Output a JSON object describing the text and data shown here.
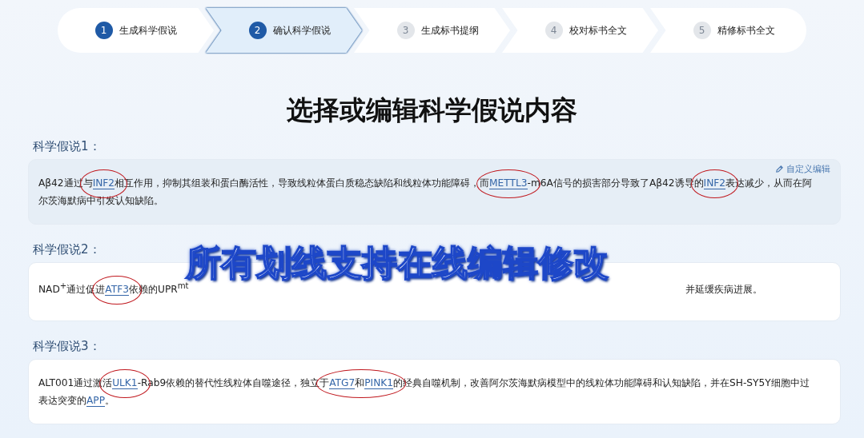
{
  "steps": [
    {
      "number": "1",
      "label": "生成科学假说",
      "selected": false,
      "done": true
    },
    {
      "number": "2",
      "label": "确认科学假说",
      "selected": true,
      "done": false
    },
    {
      "number": "3",
      "label": "生成标书提纲",
      "selected": false,
      "done": false
    },
    {
      "number": "4",
      "label": "校对标书全文",
      "selected": false,
      "done": false
    },
    {
      "number": "5",
      "label": "精修标书全文",
      "selected": false,
      "done": false
    }
  ],
  "title": "选择或编辑科学假说内容",
  "hypotheses": [
    {
      "label": "科学假说1：",
      "selected": true,
      "edit_action": "自定义编辑",
      "lines": [
        [
          {
            "kind": "text",
            "text": "Aβ42通过与"
          },
          {
            "kind": "circled",
            "parts": [
              {
                "kind": "link",
                "text": "INF2"
              }
            ]
          },
          {
            "kind": "text",
            "text": "相互作用，抑制其组装和蛋白酶活性，导致线粒体蛋白质稳态缺陷和线粒体功能障碍，而"
          },
          {
            "kind": "circled",
            "parts": [
              {
                "kind": "link",
                "text": "METTL3"
              }
            ]
          },
          {
            "kind": "text",
            "text": "-m6A信号的损害部分导致了Aβ42诱导的"
          },
          {
            "kind": "circled",
            "parts": [
              {
                "kind": "link",
                "text": "INF2"
              }
            ]
          },
          {
            "kind": "text",
            "text": "表达减少，从而在阿"
          }
        ],
        [
          {
            "kind": "text",
            "text": "尔茨海默病中引发认知缺陷。"
          }
        ]
      ]
    },
    {
      "label": "科学假说2：",
      "selected": false,
      "lines": [
        [
          {
            "kind": "text",
            "text": "NAD$^{+}$通过促进"
          },
          {
            "kind": "circled",
            "parts": [
              {
                "kind": "link",
                "text": "ATF3"
              }
            ]
          },
          {
            "kind": "text",
            "text": "依赖的UPR$^{mt}$"
          },
          {
            "kind": "gap"
          },
          {
            "kind": "text",
            "text": "并延缓疾病进展。"
          }
        ]
      ]
    },
    {
      "label": "科学假说3：",
      "selected": false,
      "lines": [
        [
          {
            "kind": "text",
            "text": "ALT001通过激活"
          },
          {
            "kind": "circled",
            "parts": [
              {
                "kind": "link",
                "text": "ULK1"
              }
            ]
          },
          {
            "kind": "text",
            "text": "-Rab9依赖的替代性线粒体自噬途径，独立于"
          },
          {
            "kind": "circled",
            "parts": [
              {
                "kind": "link",
                "text": "ATG7"
              },
              {
                "kind": "text",
                "text": "和"
              },
              {
                "kind": "link",
                "text": "PINK1"
              }
            ]
          },
          {
            "kind": "text",
            "text": "的经典自噬机制，改善阿尔茨海默病模型中的线粒体功能障碍和认知缺陷，并在SH-SY5Y细胞中过"
          }
        ],
        [
          {
            "kind": "text",
            "text": "表达突变的"
          },
          {
            "kind": "link",
            "text": "APP"
          },
          {
            "kind": "text",
            "text": "。"
          }
        ]
      ]
    }
  ],
  "caption": "所有划线支持在线编辑修改"
}
